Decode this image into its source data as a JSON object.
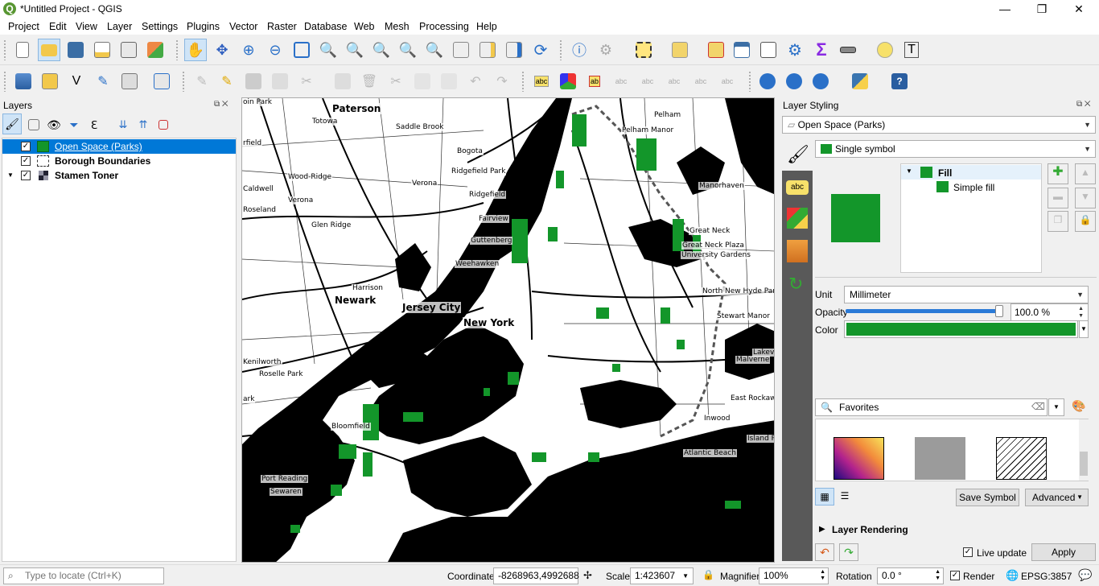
{
  "window": {
    "title": "*Untitled Project - QGIS",
    "minimize": "—",
    "restore": "❐",
    "close": "✕"
  },
  "menu": [
    "Project",
    "Edit",
    "View",
    "Layer",
    "Settings",
    "Plugins",
    "Vector",
    "Raster",
    "Database",
    "Web",
    "Mesh",
    "Processing",
    "Help"
  ],
  "layers_panel": {
    "title": "Layers",
    "layers": [
      {
        "name": "Open Space (Parks)",
        "checked": "✓",
        "selected": true
      },
      {
        "name": "Borough Boundaries",
        "checked": "✓",
        "selected": false
      },
      {
        "name": "Stamen Toner",
        "checked": "✓",
        "selected": false
      }
    ]
  },
  "map": {
    "labels": [
      "Paterson",
      "Totowa",
      "Saddle Brook",
      "Bogota",
      "Ridgefield Park",
      "Ridgefield",
      "Fairview",
      "Guttenberg",
      "Weehawken",
      "Cedar Grove",
      "Wood-Ridge",
      "Verona",
      "Caldwell",
      "Roseland",
      "Glen Ridge",
      "Harrison",
      "Newark",
      "Jersey City",
      "New York",
      "Kenilworth",
      "Roselle Park",
      "Port Reading",
      "Sewaren",
      "Pelham",
      "Pelham Manor",
      "Manorhaven",
      "Great Neck",
      "Great Neck Plaza",
      "University Gardens",
      "North New Hyde Park",
      "Stewart Manor",
      "Lakeview",
      "Malverne",
      "East Rockaway",
      "Inwood",
      "Atlantic Beach",
      "Island Park",
      "Bloomfield",
      "oin Park",
      "rfield",
      "ark"
    ]
  },
  "styling": {
    "title": "Layer Styling",
    "layer_combo": "Open Space (Parks)",
    "renderer": "Single symbol",
    "symbol_tree": {
      "root": "Fill",
      "child": "Simple fill"
    },
    "fill_color": "#13962a",
    "unit_label": "Unit",
    "unit_value": "Millimeter",
    "opacity_label": "Opacity",
    "opacity_value": "100.0 %",
    "opacity_fraction": 1.0,
    "color_label": "Color",
    "search_value": "Favorites",
    "save_symbol": "Save Symbol",
    "advanced": "Advanced",
    "layer_rendering": "Layer Rendering",
    "live_update": "Live update",
    "apply": "Apply",
    "tabs_abc": "abc"
  },
  "status": {
    "locator_placeholder": "Type to locate (Ctrl+K)",
    "coordinate_label": "Coordinate",
    "coordinate_value": "-8268963,4992688",
    "scale_label": "Scale",
    "scale_value": "1:423607",
    "magnifier_label": "Magnifier",
    "magnifier_value": "100%",
    "rotation_label": "Rotation",
    "rotation_value": "0.0 °",
    "render_label": "Render",
    "crs": "EPSG:3857"
  }
}
